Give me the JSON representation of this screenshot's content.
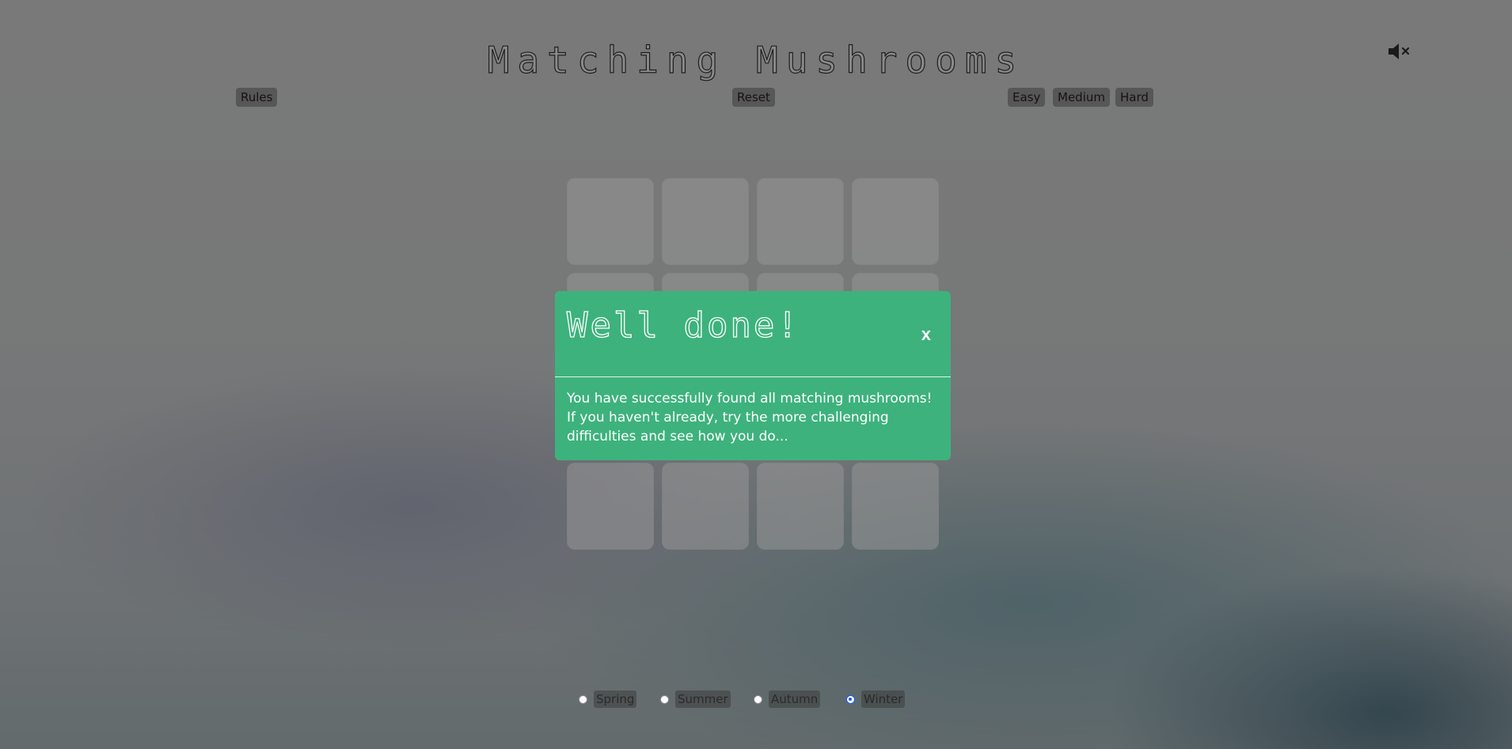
{
  "title": "Matching Mushrooms",
  "sound_icon": "speaker-muted-icon",
  "controls": {
    "rules_label": "Rules",
    "reset_label": "Reset",
    "difficulty": [
      "Easy",
      "Medium",
      "Hard"
    ]
  },
  "modal": {
    "title": "Well done!",
    "close_label": "x",
    "message": "You have successfully found all matching mushrooms! If you haven't already, try the more challenging difficulties and see how you do..."
  },
  "seasons": [
    {
      "label": "Spring",
      "checked": false
    },
    {
      "label": "Summer",
      "checked": false
    },
    {
      "label": "Autumn",
      "checked": false
    },
    {
      "label": "Winter",
      "checked": true
    }
  ],
  "colors": {
    "modal_bg": "#3db27d",
    "radio_selected": "#1a5cff"
  }
}
